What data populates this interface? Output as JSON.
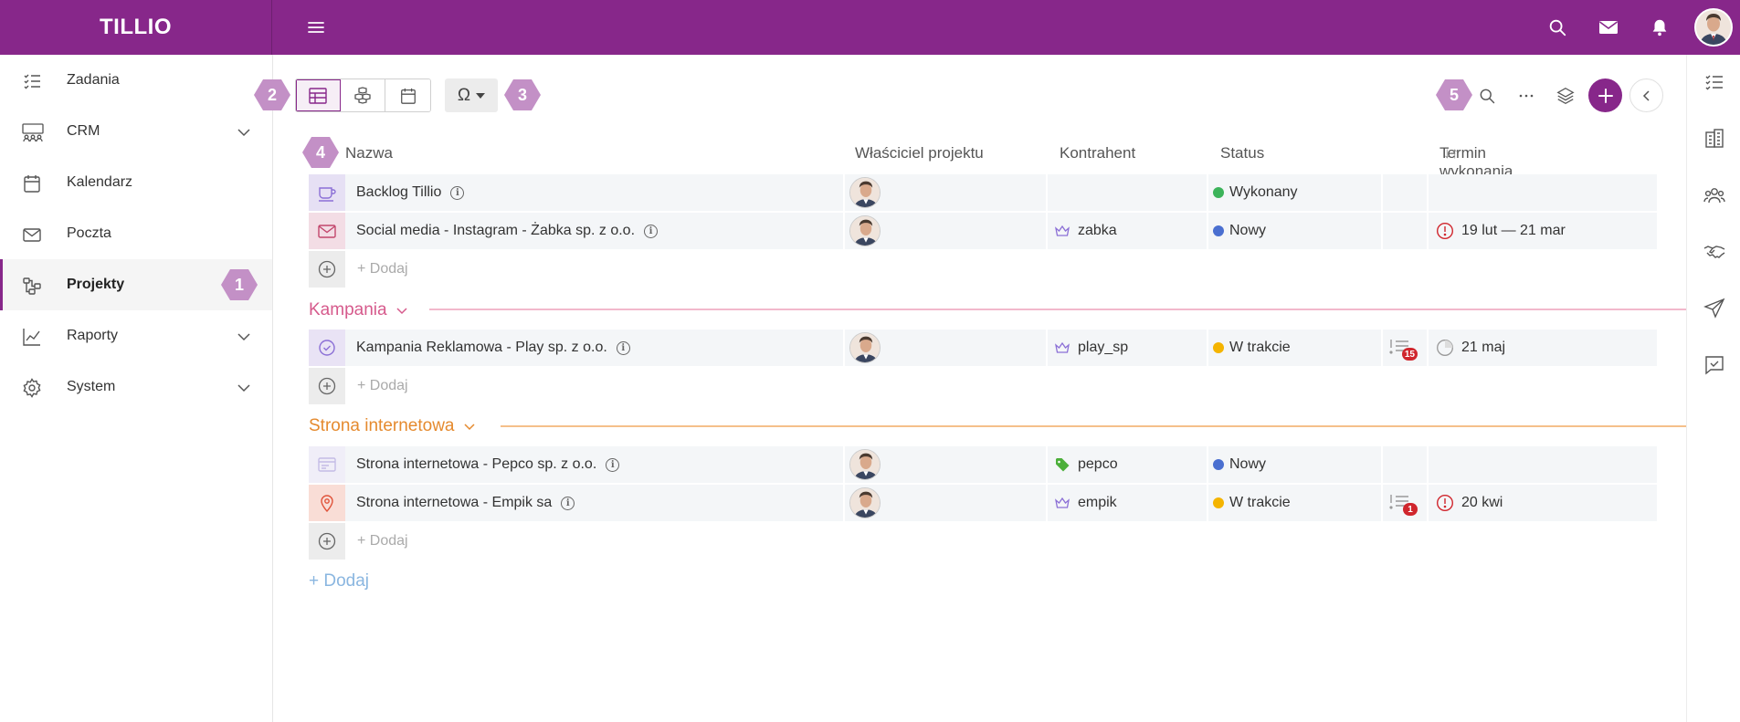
{
  "app": {
    "logo": "TILLIO",
    "brand_color": "#87278a"
  },
  "sidebar": {
    "items": [
      {
        "label": "Zadania",
        "icon": "checklist-icon",
        "has_chevron": false,
        "active": false
      },
      {
        "label": "CRM",
        "icon": "crm-icon",
        "has_chevron": true,
        "active": false
      },
      {
        "label": "Kalendarz",
        "icon": "calendar-icon",
        "has_chevron": false,
        "active": false
      },
      {
        "label": "Poczta",
        "icon": "mail-icon",
        "has_chevron": false,
        "active": false
      },
      {
        "label": "Projekty",
        "icon": "projects-icon",
        "has_chevron": false,
        "active": true
      },
      {
        "label": "Raporty",
        "icon": "chart-icon",
        "has_chevron": true,
        "active": false
      },
      {
        "label": "System",
        "icon": "gear-icon",
        "has_chevron": true,
        "active": false
      }
    ]
  },
  "markers": {
    "m1": "1",
    "m2": "2",
    "m3": "3",
    "m4": "4",
    "m5": "5"
  },
  "toolbar": {
    "omega": "Ω"
  },
  "table": {
    "columns": {
      "name": "Nazwa",
      "owner": "Właściciel projektu",
      "contractor": "Kontrahent",
      "status": "Status",
      "deadline": "Termin wykonania",
      "sort_icon": "↓↑"
    },
    "add_label": "+ Dodaj",
    "groups": [
      {
        "title": "",
        "rows": [
          {
            "name": "Backlog Tillio",
            "icon": "cup-icon",
            "icon_bg": "#e6e0f4",
            "contractor": "",
            "contractor_icon": "",
            "status": "Wykonany",
            "status_color": "#3cb35a",
            "tasks": "",
            "deadline": "",
            "deadline_icon": ""
          },
          {
            "name": "Social media - Instagram - Żabka sp. z o.o.",
            "icon": "envelope-icon",
            "icon_bg": "#f3dde5",
            "contractor": "zabka",
            "contractor_icon": "crown-icon",
            "status": "Nowy",
            "status_color": "#4a6fd0",
            "tasks": "",
            "deadline": "19 lut — 21 mar",
            "deadline_icon": "alert-icon"
          }
        ]
      },
      {
        "title": "Kampania",
        "color": "#d65a8c",
        "line_color": "#f2b8cc",
        "rows": [
          {
            "name": "Kampania Reklamowa - Play sp. z o.o.",
            "icon": "check-badge-icon",
            "icon_bg": "#e9e3f5",
            "contractor": "play_sp",
            "contractor_icon": "crown-icon",
            "status": "W trakcie",
            "status_color": "#f4b400",
            "tasks": "15",
            "deadline": "21 maj",
            "deadline_icon": "pie-icon"
          }
        ]
      },
      {
        "title": "Strona internetowa",
        "color": "#e58a2e",
        "line_color": "#f5c08a",
        "rows": [
          {
            "name": "Strona internetowa - Pepco sp. z o.o.",
            "icon": "card-icon",
            "icon_bg": "#f0eef8",
            "contractor": "pepco",
            "contractor_icon": "tag-icon",
            "status": "Nowy",
            "status_color": "#4a6fd0",
            "tasks": "",
            "deadline": "",
            "deadline_icon": ""
          },
          {
            "name": "Strona internetowa - Empik sa",
            "icon": "pin-icon",
            "icon_bg": "#f9ddd6",
            "contractor": "empik",
            "contractor_icon": "crown-icon",
            "status": "W trakcie",
            "status_color": "#f4b400",
            "tasks": "1",
            "deadline": "20 kwi",
            "deadline_icon": "alert-icon"
          }
        ]
      }
    ],
    "bottom_add": "+ Dodaj"
  }
}
